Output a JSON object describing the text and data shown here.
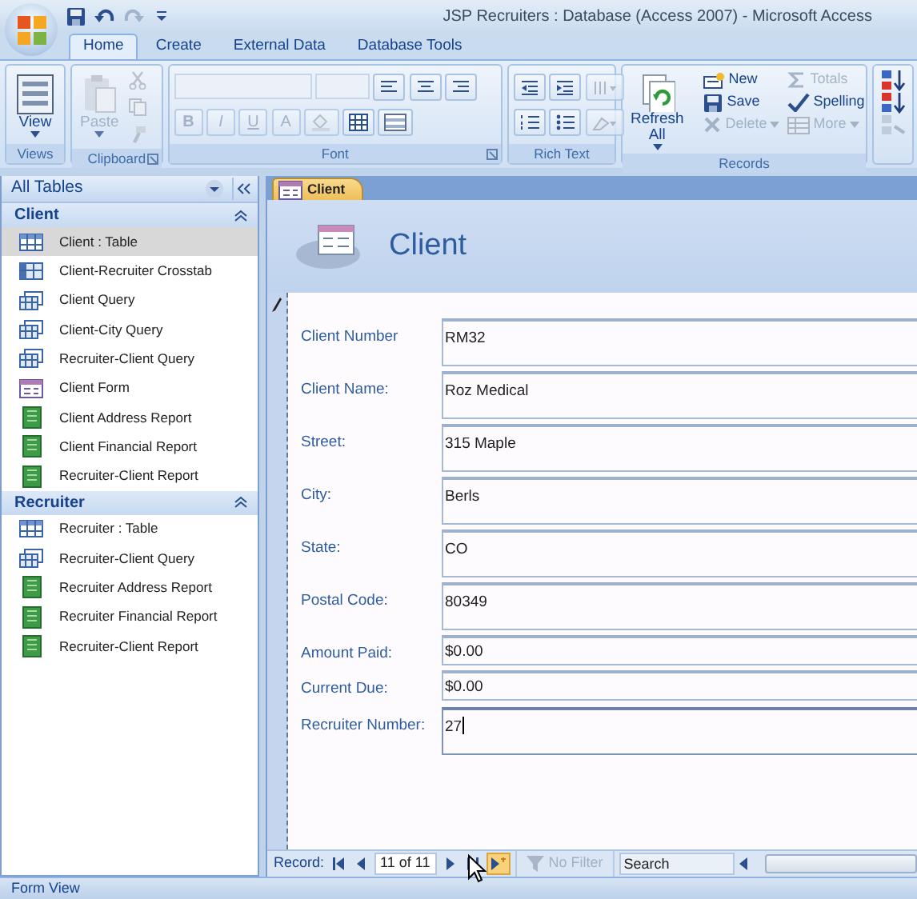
{
  "window": {
    "title": "JSP Recruiters : Database (Access 2007) - Microsoft Access"
  },
  "quick_access": [
    {
      "kind": "save",
      "disabled": false
    },
    {
      "kind": "undo",
      "disabled": false
    },
    {
      "kind": "redo",
      "disabled": true
    },
    {
      "kind": "customize",
      "disabled": false
    }
  ],
  "ribbon_tabs": [
    {
      "label": "Home",
      "selected": true
    },
    {
      "label": "Create",
      "selected": false
    },
    {
      "label": "External Data",
      "selected": false
    },
    {
      "label": "Database Tools",
      "selected": false
    }
  ],
  "ribbon_groups": [
    {
      "label": "Views",
      "launcher": false,
      "buttons": [
        {
          "kind": "view",
          "label": "View",
          "disabled": false
        }
      ]
    },
    {
      "label": "Clipboard",
      "launcher": true,
      "buttons": [
        {
          "kind": "paste",
          "label": "Paste",
          "disabled": true
        },
        {
          "kind": "cut",
          "disabled": true
        },
        {
          "kind": "copy",
          "disabled": true
        },
        {
          "kind": "painter",
          "disabled": true
        }
      ]
    },
    {
      "label": "Font",
      "launcher": true,
      "buttons": [
        {
          "kind": "font-box",
          "disabled": true
        },
        {
          "kind": "size-box",
          "disabled": true
        },
        {
          "kind": "align-left",
          "disabled": false
        },
        {
          "kind": "align-center",
          "disabled": false
        },
        {
          "kind": "align-right",
          "disabled": false
        },
        {
          "kind": "bold",
          "label": "B",
          "disabled": true
        },
        {
          "kind": "italic",
          "label": "I",
          "disabled": true
        },
        {
          "kind": "underline",
          "label": "U",
          "disabled": true
        },
        {
          "kind": "font-color",
          "label": "A",
          "disabled": true
        },
        {
          "kind": "fill",
          "disabled": true
        },
        {
          "kind": "gridlines",
          "disabled": false
        },
        {
          "kind": "alt-fill",
          "disabled": false
        }
      ]
    },
    {
      "label": "Rich Text",
      "launcher": false,
      "buttons": [
        {
          "kind": "outdent",
          "disabled": false
        },
        {
          "kind": "indent",
          "disabled": false
        },
        {
          "kind": "direction",
          "disabled": true
        },
        {
          "kind": "numbers",
          "disabled": false
        },
        {
          "kind": "bullets",
          "disabled": false
        },
        {
          "kind": "highlight",
          "disabled": true
        }
      ]
    },
    {
      "label": "Records",
      "launcher": false,
      "buttons": [
        {
          "kind": "refresh",
          "label": "Refresh All",
          "disabled": false
        },
        {
          "kind": "new",
          "label": "New",
          "disabled": false
        },
        {
          "kind": "save",
          "label": "Save",
          "disabled": false
        },
        {
          "kind": "delete",
          "label": "Delete",
          "disabled": true
        },
        {
          "kind": "totals",
          "label": "Totals",
          "disabled": true
        },
        {
          "kind": "spelling",
          "label": "Spelling",
          "disabled": false
        },
        {
          "kind": "more",
          "label": "More",
          "disabled": true
        }
      ]
    },
    {
      "buttons": [
        {
          "kind": "sort-asc",
          "disabled": false
        },
        {
          "kind": "sort-desc",
          "disabled": false
        },
        {
          "kind": "clear-sort",
          "disabled": true
        }
      ]
    }
  ],
  "nav_pane": {
    "title": "All Tables",
    "groups": [
      {
        "label": "Client",
        "expanded": true,
        "items": [
          {
            "kind": "table",
            "label": "Client : Table",
            "selected": true
          },
          {
            "kind": "crosstab",
            "label": "Client-Recruiter Crosstab",
            "selected": false
          },
          {
            "kind": "query",
            "label": "Client Query",
            "selected": false
          },
          {
            "kind": "query",
            "label": "Client-City Query",
            "selected": false
          },
          {
            "kind": "query",
            "label": "Recruiter-Client Query",
            "selected": false
          },
          {
            "kind": "form",
            "label": "Client Form",
            "selected": false
          },
          {
            "kind": "report",
            "label": "Client Address Report",
            "selected": false
          },
          {
            "kind": "report",
            "label": "Client Financial Report",
            "selected": false
          },
          {
            "kind": "report",
            "label": "Recruiter-Client Report",
            "selected": false
          }
        ]
      },
      {
        "label": "Recruiter",
        "expanded": true,
        "items": [
          {
            "kind": "table",
            "label": "Recruiter : Table",
            "selected": false
          },
          {
            "kind": "query",
            "label": "Recruiter-Client Query",
            "selected": false
          },
          {
            "kind": "report",
            "label": "Recruiter Address Report",
            "selected": false
          },
          {
            "kind": "report",
            "label": "Recruiter Financial Report",
            "selected": false
          },
          {
            "kind": "report",
            "label": "Recruiter-Client Report",
            "selected": false
          }
        ]
      }
    ]
  },
  "document_tab": {
    "label": "Client",
    "selected": true
  },
  "form": {
    "title": "Client",
    "dirty": true,
    "fields": [
      {
        "label": "Client Number",
        "value": "RM32",
        "tall": true,
        "focused": false
      },
      {
        "label": "Client Name:",
        "value": "Roz Medical",
        "tall": true,
        "focused": false
      },
      {
        "label": "Street:",
        "value": "315 Maple",
        "tall": true,
        "focused": false
      },
      {
        "label": "City:",
        "value": "Berls",
        "tall": true,
        "focused": false
      },
      {
        "label": "State:",
        "value": "CO",
        "tall": true,
        "focused": false
      },
      {
        "label": "Postal Code:",
        "value": "80349",
        "tall": true,
        "focused": false
      },
      {
        "label": "Amount Paid:",
        "value": "$0.00",
        "tall": false,
        "focused": false
      },
      {
        "label": "Current Due:",
        "value": "$0.00",
        "tall": false,
        "focused": false
      },
      {
        "label": "Recruiter Number:",
        "value": "27",
        "tall": true,
        "focused": true
      }
    ]
  },
  "record_nav": {
    "label": "Record:",
    "position": "11 of 11",
    "filter": "No Filter",
    "filter_active": false,
    "search_placeholder": "Search"
  },
  "status_bar": {
    "text": "Form View"
  }
}
